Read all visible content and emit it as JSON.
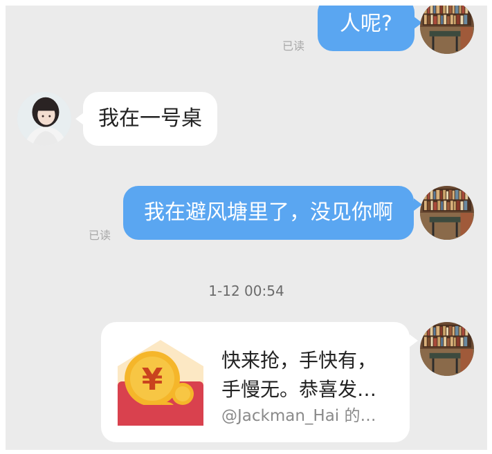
{
  "messages": [
    {
      "side": "right",
      "text": "人呢?",
      "read_status": "已读"
    },
    {
      "side": "left",
      "text": "我在一号桌"
    },
    {
      "side": "right",
      "text": "我在避风塘里了，没见你啊",
      "read_status": "已读"
    }
  ],
  "timestamp": "1-12 00:54",
  "red_packet": {
    "line1": "快来抢，手快有，",
    "line2": "手慢无。恭喜发…",
    "sender": "@Jackman_Hai 的…",
    "icon": "red-envelope-coin-icon"
  },
  "colors": {
    "background": "#ebebeb",
    "outgoing_bubble": "#5aa6f1",
    "incoming_bubble": "#ffffff",
    "read_text": "#a8a8a8",
    "red_envelope": "#d9414e",
    "coin": "#f5b62a"
  },
  "avatars": {
    "self": "bookshelf-room-avatar",
    "other": "girl-portrait-avatar"
  }
}
